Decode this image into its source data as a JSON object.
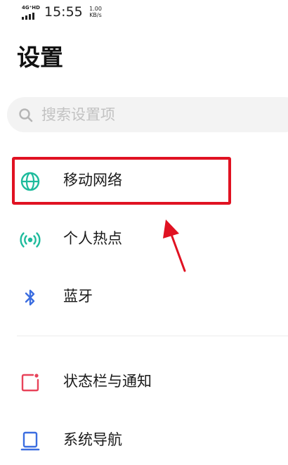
{
  "status_bar": {
    "network": "4G⁺HD",
    "time": "15:55",
    "speed_value": "1.00",
    "speed_unit": "KB/s"
  },
  "title": "设置",
  "search": {
    "placeholder": "搜索设置项",
    "icon": "search-icon"
  },
  "items": [
    {
      "label": "移动网络",
      "icon": "globe-icon",
      "color": "#1dbb9c"
    },
    {
      "label": "个人热点",
      "icon": "hotspot-icon",
      "color": "#1dbb9c"
    },
    {
      "label": "蓝牙",
      "icon": "bluetooth-icon",
      "color": "#3b6de0"
    },
    {
      "label": "状态栏与通知",
      "icon": "status-bar-icon",
      "color": "#e8435a"
    },
    {
      "label": "系统导航",
      "icon": "navigation-icon",
      "color": "#3b6de0"
    }
  ],
  "annotation": {
    "color": "#e01222",
    "target": "移动网络"
  }
}
